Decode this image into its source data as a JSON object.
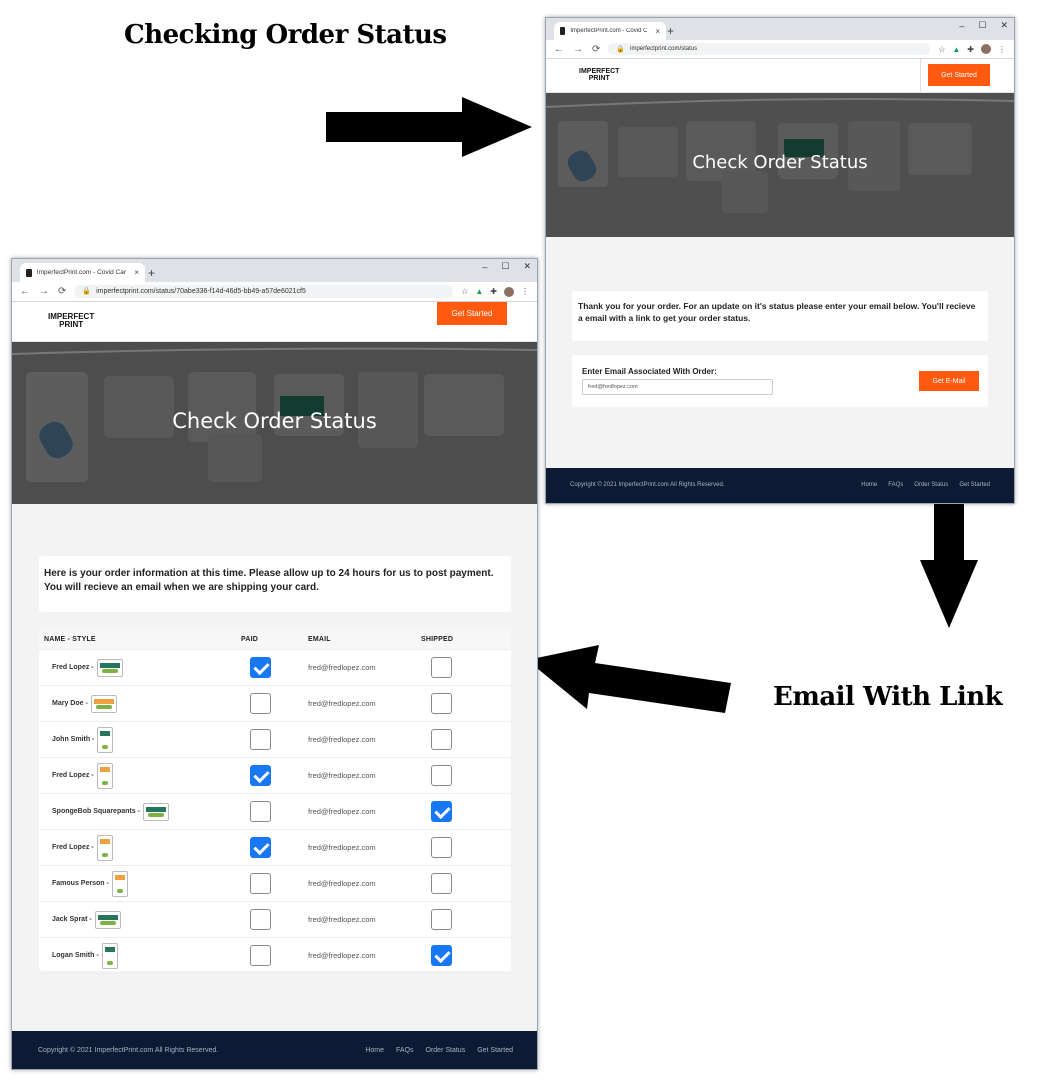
{
  "captions": {
    "top": "Checking Order Status",
    "right": "Email With Link"
  },
  "browser": {
    "tab_title": "ImperfectPrint.com - Covid Card",
    "tab_close": "×",
    "new_tab": "+",
    "minimize": "–",
    "maximize": "☐",
    "close": "✕",
    "back": "←",
    "forward": "→",
    "reload": "⟳",
    "lock": "🔒",
    "star": "☆",
    "puzzle": "✚",
    "menu": "⋮"
  },
  "status_page": {
    "url": "imperfectprint.com/status",
    "logo_line1": "IMPERFECT",
    "logo_line2": "PRINT",
    "get_started": "Get Started",
    "hero_title": "Check Order Status",
    "intro": "Thank you for your order. For an update on it's status please enter your email below. You'll recieve a email with a link to get your order status.",
    "email_label": "Enter Email Associated With Order:",
    "email_value": "fred@fredlopez.com",
    "submit": "Get E-Mail",
    "copyright": "Copyright © 2021 ImperfectPrint.com All Rights Reserved.",
    "footer_links": [
      "Home",
      "FAQs",
      "Order Status",
      "Get Started"
    ]
  },
  "order_page": {
    "url": "imperfectprint.com/status/70abe336-f14d-46d5-bb49-a57de6021cf5",
    "logo_line1": "IMPERFECT",
    "logo_line2": "PRINT",
    "get_started": "Get Started",
    "hero_title": "Check Order Status",
    "intro": "Here is your order information at this time. Please allow up to 24 hours for us to post payment. You will recieve an email when we are shipping your card.",
    "columns": [
      "NAME - STYLE",
      "PAID",
      "EMAIL",
      "SHIPPED"
    ],
    "rows": [
      {
        "name": "Fred Lopez -",
        "style": "horizontal",
        "paid": true,
        "email": "fred@fredlopez.com",
        "shipped": false
      },
      {
        "name": "Mary Doe -",
        "style": "horizontal-alt",
        "paid": false,
        "email": "fred@fredlopez.com",
        "shipped": false
      },
      {
        "name": "John Smith -",
        "style": "vertical",
        "paid": false,
        "email": "fred@fredlopez.com",
        "shipped": false
      },
      {
        "name": "Fred Lopez -",
        "style": "vertical-alt",
        "paid": true,
        "email": "fred@fredlopez.com",
        "shipped": false
      },
      {
        "name": "SpongeBob Squarepants -",
        "style": "horizontal",
        "paid": false,
        "email": "fred@fredlopez.com",
        "shipped": true
      },
      {
        "name": "Fred Lopez -",
        "style": "vertical-alt",
        "paid": true,
        "email": "fred@fredlopez.com",
        "shipped": false
      },
      {
        "name": "Famous Person -",
        "style": "vertical-alt",
        "paid": false,
        "email": "fred@fredlopez.com",
        "shipped": false
      },
      {
        "name": "Jack Sprat -",
        "style": "horizontal",
        "paid": false,
        "email": "fred@fredlopez.com",
        "shipped": false
      },
      {
        "name": "Logan Smith -",
        "style": "vertical",
        "paid": false,
        "email": "fred@fredlopez.com",
        "shipped": true
      }
    ],
    "copyright": "Copyright © 2021 ImperfectPrint.com All Rights Reserved.",
    "footer_links": [
      "Home",
      "FAQs",
      "Order Status",
      "Get Started"
    ]
  },
  "colors": {
    "accent_orange": "#ff5a0f",
    "footer_navy": "#0d1a33",
    "checkbox_blue": "#1877f2"
  }
}
